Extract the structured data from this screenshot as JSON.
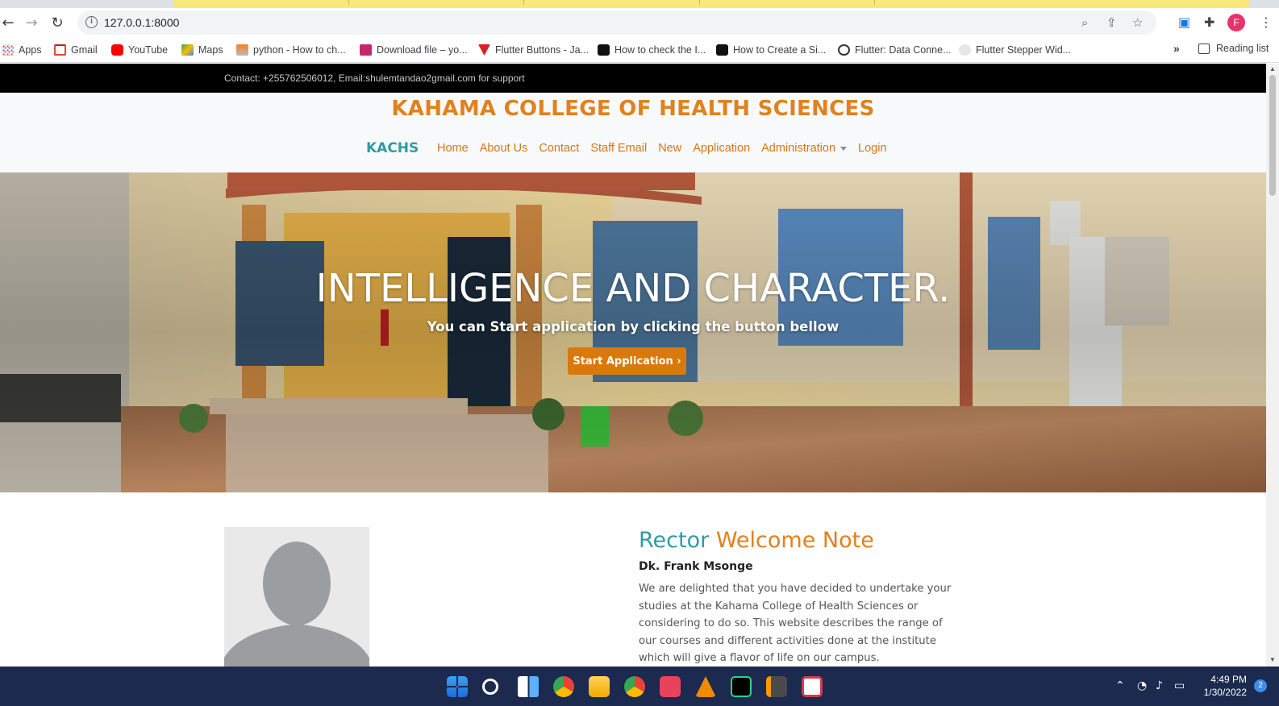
{
  "browser": {
    "url": "127.0.0.1:8000",
    "bookmarks": [
      "Apps",
      "Gmail",
      "YouTube",
      "Maps",
      "python - How to ch...",
      "Download file – yo...",
      "Flutter Buttons - Ja...",
      "How to check the I...",
      "How to Create a Si...",
      "Flutter: Data Conne...",
      "Flutter Stepper Wid..."
    ],
    "bookmark_colors": [
      "#ea4335",
      "#ea4335",
      "#ff0000",
      "#34a853",
      "#e37400",
      "#c4286c",
      "#d81f26",
      "#111111",
      "#111111",
      "#333333",
      "#888888"
    ],
    "reading_list": "Reading list",
    "profile_initial": "F",
    "overflow_label": "»"
  },
  "site": {
    "contact_bar": "Contact: +255762506012, Email:shulemtandao2gmail.com for support",
    "college_name": "KAHAMA COLLEGE OF HEALTH SCIENCES",
    "brand": "KACHS",
    "nav": [
      "Home",
      "About Us",
      "Contact",
      "Staff Email",
      "New",
      "Application",
      "Administration",
      "Login"
    ],
    "hero": {
      "title": "INTELLIGENCE AND CHARACTER.",
      "subtitle": "You can Start application by clicking the button bellow",
      "button": "Start Application ›"
    },
    "rector": {
      "title_part1": "Rector",
      "title_part2": "Welcome Note",
      "name": "Dk. Frank Msonge",
      "body": "We are delighted that you have decided to undertake your studies at the Kahama College of Health Sciences or considering to do so. This website describes the range of our courses and different activities done at the institute which will give a flavor of life on our campus."
    },
    "colors": {
      "accent_orange": "#e1811e",
      "accent_teal": "#2f9ba6",
      "topbar": "#000000",
      "button": "#d9790c"
    }
  },
  "taskbar": {
    "time": "4:49 PM",
    "date": "1/30/2022",
    "notifications": "2",
    "apps": [
      "windows-start-icon",
      "search-icon",
      "widgets-icon",
      "chrome-icon",
      "file-explorer-icon",
      "chrome-profile-icon",
      "git-app-icon",
      "vlc-icon",
      "pycharm-icon",
      "sublime-text-icon",
      "snipping-tool-icon"
    ]
  }
}
